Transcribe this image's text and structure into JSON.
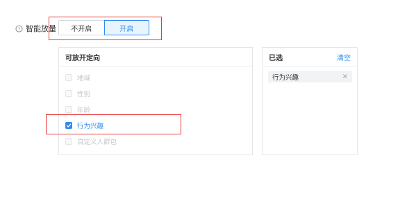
{
  "setting": {
    "label": "智能放量",
    "help_icon": "question-circle-icon",
    "toggle": {
      "off_label": "不开启",
      "on_label": "开启",
      "selected": "开启"
    }
  },
  "left_panel": {
    "title": "可放开定向",
    "options": [
      {
        "label": "地域",
        "state": "disabled"
      },
      {
        "label": "性别",
        "state": "disabled"
      },
      {
        "label": "年龄",
        "state": "disabled"
      },
      {
        "label": "行为兴趣",
        "state": "checked"
      },
      {
        "label": "自定义人群包",
        "state": "disabled"
      }
    ]
  },
  "right_panel": {
    "title": "已选",
    "clear_label": "清空",
    "selected": [
      {
        "label": "行为兴趣",
        "remove_icon": "close-icon"
      }
    ]
  },
  "colors": {
    "accent": "#2d8cf0",
    "highlight": "#e53935"
  }
}
